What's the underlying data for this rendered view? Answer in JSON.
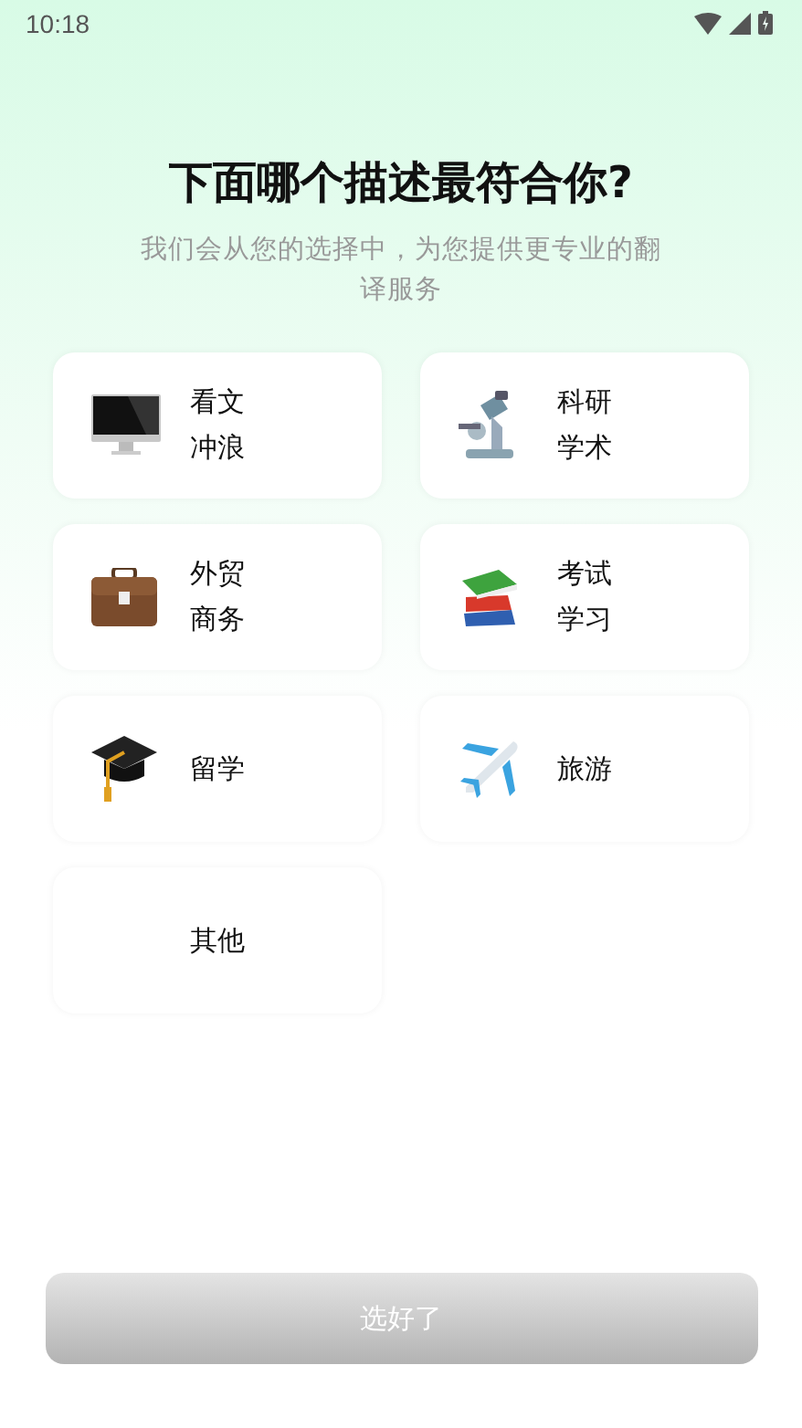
{
  "status_bar": {
    "time": "10:18"
  },
  "title": "下面哪个描述最符合你?",
  "subtitle": "我们会从您的选择中，为您提供更专业的翻译服务",
  "options": [
    {
      "lines": [
        "看文",
        "冲浪"
      ],
      "selected": false
    },
    {
      "lines": [
        "科研",
        "学术"
      ],
      "selected": false
    },
    {
      "lines": [
        "外贸",
        "商务"
      ],
      "selected": false
    },
    {
      "lines": [
        "考试",
        "学习"
      ],
      "selected": false
    },
    {
      "lines": [
        "留学"
      ],
      "selected": false
    },
    {
      "lines": [
        "旅游"
      ],
      "selected": false
    },
    {
      "lines": [
        "其他"
      ],
      "selected": false
    }
  ],
  "confirm_button": {
    "label": "选好了",
    "disabled": true
  }
}
